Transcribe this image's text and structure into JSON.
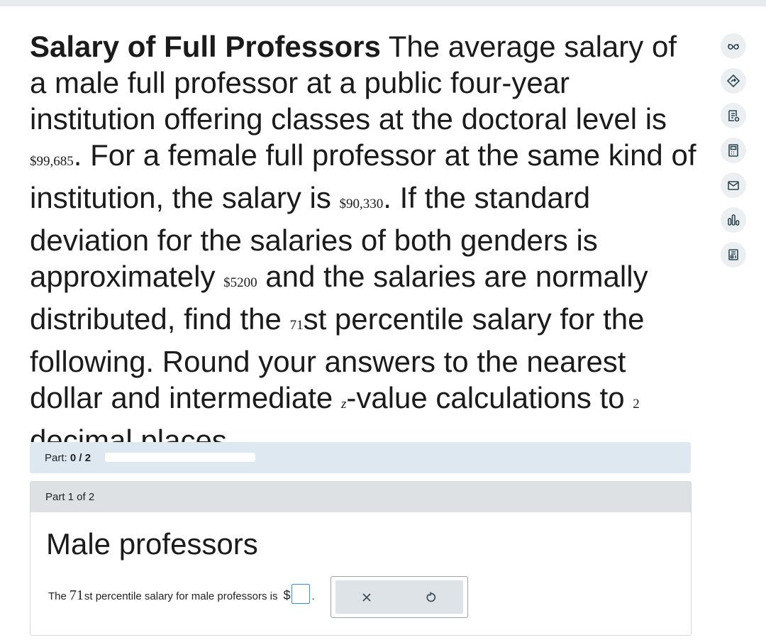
{
  "question": {
    "title": "Salary of Full Professors",
    "text_1": " The average salary of a male full professor at a public four-year institution offering classes at the doctoral level is ",
    "male_salary": "$99,685",
    "text_2": ". For a female full professor at the same kind of institution, the salary is ",
    "female_salary": "$90,330",
    "text_3": ". If the standard deviation for the salaries of both genders is approximately ",
    "std_dev": "$5200",
    "text_4": " and the salaries are normally distributed, find the ",
    "percentile": "71",
    "text_5": "st percentile salary for the following. Round your answers to the nearest dollar and intermediate ",
    "z_symbol": "z",
    "text_6": "-value calculations to ",
    "decimals": "2",
    "text_7": " decimal places."
  },
  "sidebar": {
    "icons": [
      "glasses-icon",
      "tag-icon",
      "notes-icon",
      "calculator-icon",
      "mail-icon",
      "bar-chart-icon",
      "printer-icon"
    ]
  },
  "progress": {
    "label": "Part: ",
    "value": "0 / 2",
    "fraction": 0
  },
  "part": {
    "header": "Part 1 of 2",
    "title": "Male professors",
    "prompt_prefix": "The ",
    "prompt_percentile": "71",
    "prompt_suffix": "st percentile salary for male professors is",
    "currency": "$",
    "answer_value": "",
    "period": "."
  },
  "colors": {
    "accent": "#3b8fd6",
    "part_bar_bg": "#dde8f1",
    "card_header_bg": "#dde1e3"
  }
}
